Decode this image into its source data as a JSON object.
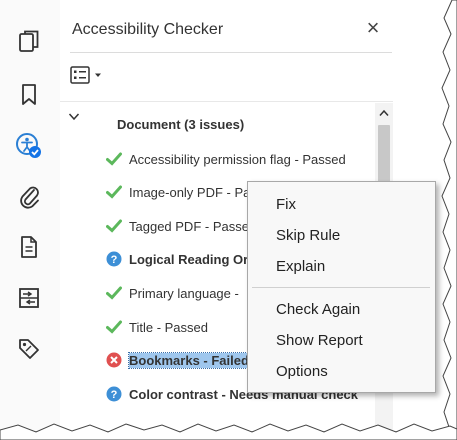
{
  "panel": {
    "title": "Accessibility Checker",
    "close_symbol": "×",
    "options_icon": "list-options-icon"
  },
  "rail": {
    "items": [
      {
        "icon": "page-thumbnails-icon"
      },
      {
        "icon": "bookmark-icon"
      },
      {
        "icon": "accessibility-icon"
      },
      {
        "icon": "attachment-icon"
      },
      {
        "icon": "document-properties-icon"
      },
      {
        "icon": "compare-icon"
      },
      {
        "icon": "tag-icon"
      }
    ]
  },
  "tree": {
    "root": {
      "label": "Document (3 issues)"
    },
    "items": [
      {
        "label": "Accessibility permission flag - Passed",
        "status": "passed"
      },
      {
        "label": "Image-only PDF - Pa",
        "status": "passed"
      },
      {
        "label": "Tagged PDF - Passe",
        "status": "passed"
      },
      {
        "label": "Logical Reading Or",
        "status": "manual"
      },
      {
        "label": "Primary language -",
        "status": "passed"
      },
      {
        "label": "Title - Passed",
        "status": "passed"
      },
      {
        "label": "Bookmarks - Failed",
        "status": "failed"
      },
      {
        "label": "Color contrast - Needs manual check",
        "status": "manual"
      }
    ]
  },
  "context_menu": {
    "items": [
      "Fix",
      "Skip Rule",
      "Explain",
      "Check Again",
      "Show Report",
      "Options"
    ]
  },
  "colors": {
    "passed": "#5cb85c",
    "manual": "#3d8fd6",
    "failed": "#e05050",
    "selection": "#9fc7ee",
    "accent": "#1473e6"
  }
}
